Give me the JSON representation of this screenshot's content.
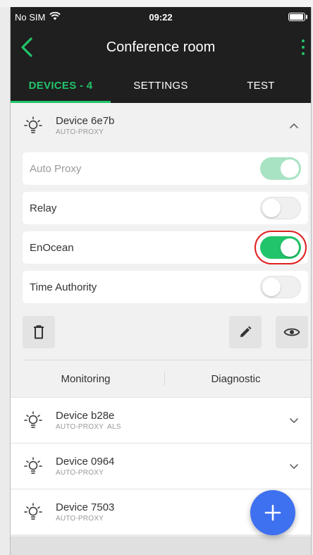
{
  "status_bar": {
    "carrier": "No SIM",
    "time": "09:22"
  },
  "app_bar": {
    "title": "Conference room"
  },
  "tabs": [
    {
      "label": "DEVICES - 4",
      "active": true
    },
    {
      "label": "SETTINGS",
      "active": false
    },
    {
      "label": "TEST",
      "active": false
    }
  ],
  "expanded_device": {
    "name": "Device 6e7b",
    "subtitle": "AUTO-PROXY",
    "settings": [
      {
        "label": "Auto Proxy",
        "state": "on",
        "disabled": true
      },
      {
        "label": "Relay",
        "state": "off",
        "disabled": false
      },
      {
        "label": "EnOcean",
        "state": "on",
        "disabled": false,
        "highlighted": true
      },
      {
        "label": "Time Authority",
        "state": "off",
        "disabled": false
      }
    ],
    "subtabs": [
      "Monitoring",
      "Diagnostic"
    ]
  },
  "devices": [
    {
      "name": "Device b28e",
      "subtitle": "AUTO-PROXY  ALS"
    },
    {
      "name": "Device 0964",
      "subtitle": "AUTO-PROXY"
    },
    {
      "name": "Device 7503",
      "subtitle": "AUTO-PROXY"
    }
  ],
  "icons": {
    "back": "chevron-left-icon",
    "more": "more-vertical-icon",
    "bulb": "lightbulb-icon",
    "delete": "trash-icon",
    "edit": "pencil-icon",
    "view": "eye-icon",
    "add": "plus-icon"
  },
  "colors": {
    "accent": "#21c46a",
    "fab": "#3e71f0",
    "bar": "#1f1f1f"
  }
}
